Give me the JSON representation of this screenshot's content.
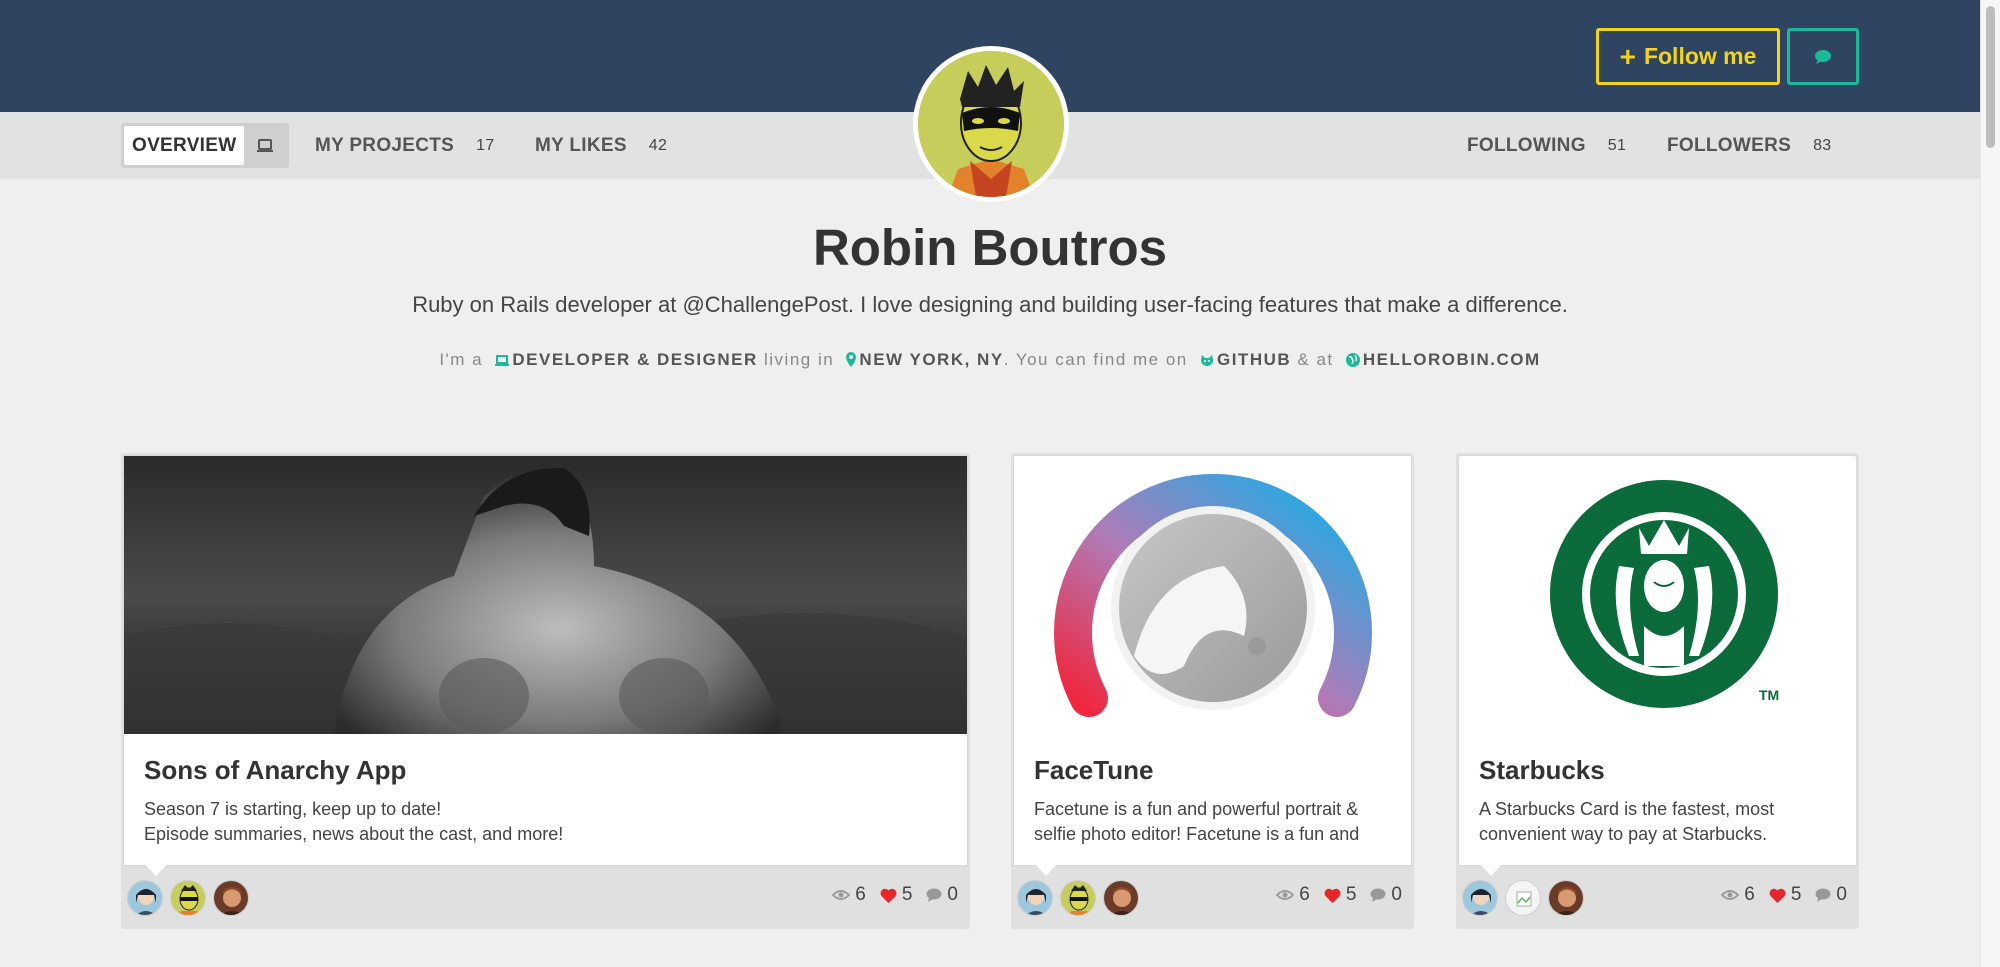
{
  "header": {
    "follow_label": "Follow me",
    "follow_icon": "plus-icon",
    "message_icon": "speech-bubble-icon",
    "banner_color": "#2f4460",
    "accent_yellow": "#f3d41b",
    "accent_teal": "#1ab99a"
  },
  "nav": {
    "overview_label": "OVERVIEW",
    "overview_icon": "laptop-icon",
    "projects_label": "MY PROJECTS",
    "projects_count": "17",
    "likes_label": "MY LIKES",
    "likes_count": "42",
    "following_label": "FOLLOWING",
    "following_count": "51",
    "followers_label": "FOLLOWERS",
    "followers_count": "83"
  },
  "profile": {
    "name": "Robin Boutros",
    "bio": "Ruby on Rails developer at @ChallengePost. I love designing and building user-facing features that make a difference.",
    "facts": {
      "im_a": "I'm a",
      "role": "DEVELOPER & DESIGNER",
      "living_in": "living in",
      "location": "NEW YORK, NY",
      "find_me": ". You can find me on",
      "github": "GITHUB",
      "and_at": "& at",
      "website": "HELLOROBIN.COM"
    }
  },
  "projects": [
    {
      "title": "Sons of Anarchy App",
      "desc_line1": "Season 7 is starting, keep up to date!",
      "desc_line2": "Episode summaries, news about the cast, and more!",
      "views": "6",
      "likes": "5",
      "comments": "0"
    },
    {
      "title": "FaceTune",
      "desc_line1": "Facetune is a fun and powerful portrait &",
      "desc_line2": "selfie photo editor! Facetune is a fun and",
      "views": "6",
      "likes": "5",
      "comments": "0"
    },
    {
      "title": "Starbucks",
      "desc_line1": "A Starbucks Card is the fastest, most",
      "desc_line2": "convenient way to pay at Starbucks.",
      "views": "6",
      "likes": "5",
      "comments": "0"
    }
  ]
}
